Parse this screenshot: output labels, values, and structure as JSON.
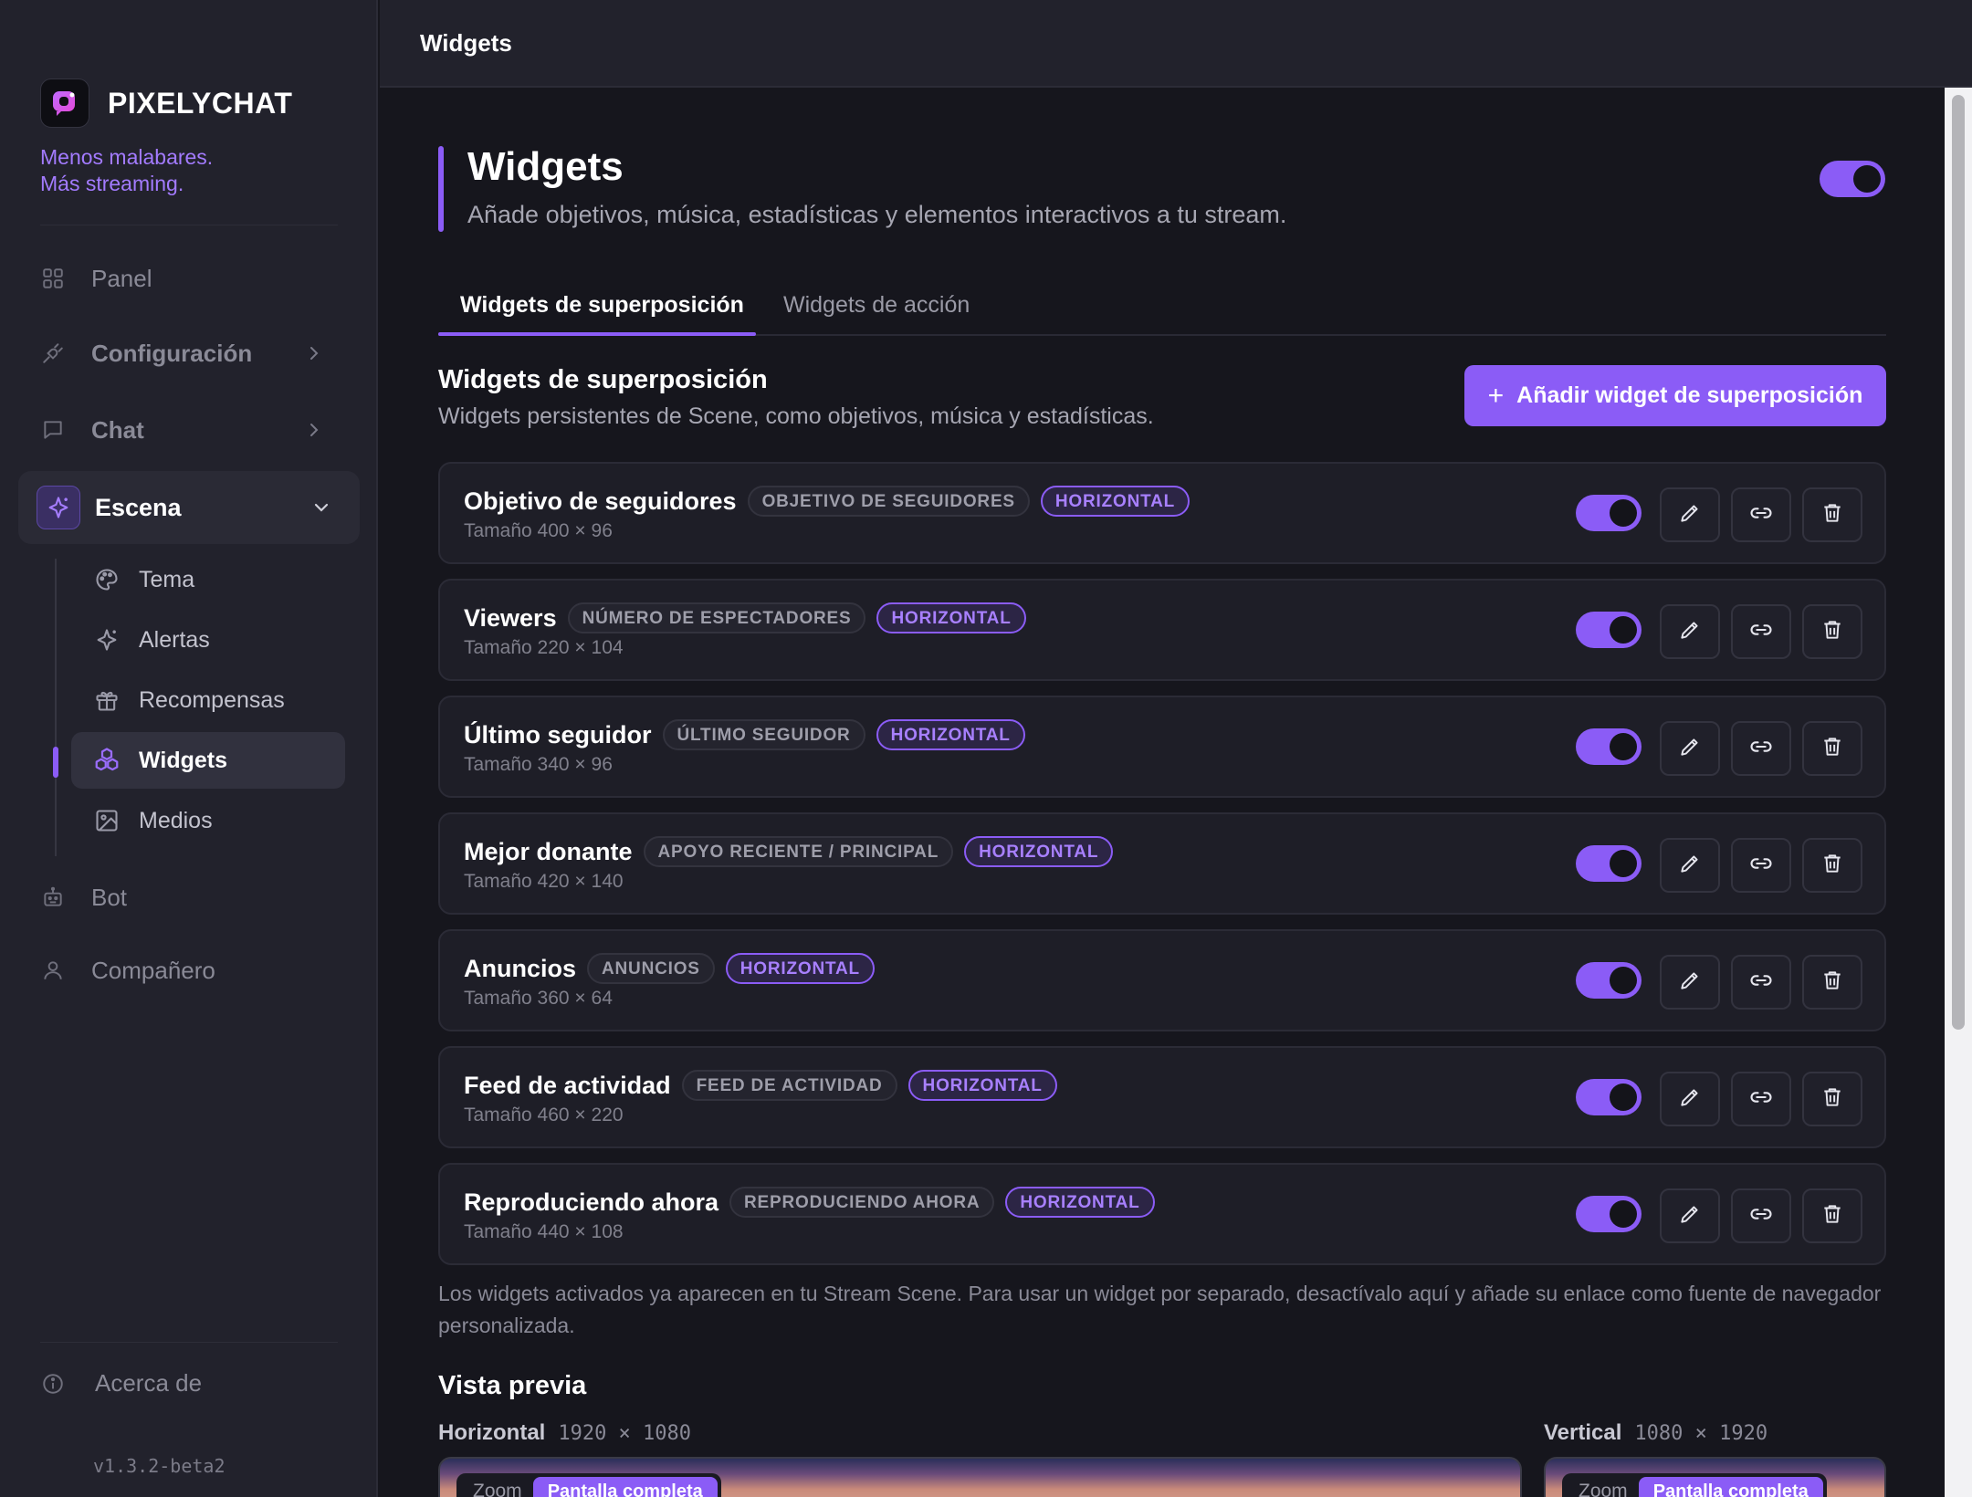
{
  "app": {
    "name": "PIXELYCHAT",
    "tagline_1": "Menos malabares.",
    "tagline_2": "Más streaming.",
    "version": "v1.3.2-beta2"
  },
  "sidebar": {
    "nav": [
      {
        "label": "Panel",
        "icon": "grid-icon"
      },
      {
        "label": "Configuración",
        "icon": "plug-icon"
      },
      {
        "label": "Chat",
        "icon": "chat-icon"
      },
      {
        "label": "Escena",
        "icon": "sparkle-icon"
      },
      {
        "label": "Bot",
        "icon": "robot-icon"
      },
      {
        "label": "Compañero",
        "icon": "user-icon"
      }
    ],
    "scene_items": [
      {
        "label": "Tema",
        "icon": "palette-icon"
      },
      {
        "label": "Alertas",
        "icon": "sparkle-icon"
      },
      {
        "label": "Recompensas",
        "icon": "gift-icon"
      },
      {
        "label": "Widgets",
        "icon": "widgets-icon"
      },
      {
        "label": "Medios",
        "icon": "image-icon"
      }
    ],
    "about": "Acerca de"
  },
  "topbar": {
    "title": "Widgets"
  },
  "page": {
    "title": "Widgets",
    "subtitle": "Añade objetivos, música, estadísticas y elementos interactivos a tu stream.",
    "enabled": true
  },
  "tabs": [
    "Widgets de superposición",
    "Widgets de acción"
  ],
  "section": {
    "title": "Widgets de superposición",
    "subtitle": "Widgets persistentes de Scene, como objetivos, música y estadísticas.",
    "add_button": "Añadir widget de superposición"
  },
  "widgets": [
    {
      "name": "Objetivo de seguidores",
      "type": "OBJETIVO DE SEGUIDORES",
      "orientation": "HORIZONTAL",
      "size": "Tamaño 400 × 96",
      "enabled": true
    },
    {
      "name": "Viewers",
      "type": "NÚMERO DE ESPECTADORES",
      "orientation": "HORIZONTAL",
      "size": "Tamaño 220 × 104",
      "enabled": true
    },
    {
      "name": "Último seguidor",
      "type": "ÚLTIMO SEGUIDOR",
      "orientation": "HORIZONTAL",
      "size": "Tamaño 340 × 96",
      "enabled": true
    },
    {
      "name": "Mejor donante",
      "type": "APOYO RECIENTE / PRINCIPAL",
      "orientation": "HORIZONTAL",
      "size": "Tamaño 420 × 140",
      "enabled": true
    },
    {
      "name": "Anuncios",
      "type": "ANUNCIOS",
      "orientation": "HORIZONTAL",
      "size": "Tamaño 360 × 64",
      "enabled": true
    },
    {
      "name": "Feed de actividad",
      "type": "FEED DE ACTIVIDAD",
      "orientation": "HORIZONTAL",
      "size": "Tamaño 460 × 220",
      "enabled": true
    },
    {
      "name": "Reproduciendo ahora",
      "type": "REPRODUCIENDO AHORA",
      "orientation": "HORIZONTAL",
      "size": "Tamaño 440 × 108",
      "enabled": true
    }
  ],
  "note": "Los widgets activados ya aparecen en tu Stream Scene. Para usar un widget por separado, desactívalo aquí y añade su enlace como fuente de navegador personalizada.",
  "preview": {
    "title": "Vista previa",
    "horizontal_label": "Horizontal",
    "horizontal_dims": "1920 × 1080",
    "vertical_label": "Vertical",
    "vertical_dims": "1080 × 1920",
    "zoom": "Zoom",
    "fullscreen": "Pantalla completa"
  },
  "colors": {
    "accent": "#8b5cf6",
    "background": "#16161d",
    "sidebar": "#22222c"
  }
}
